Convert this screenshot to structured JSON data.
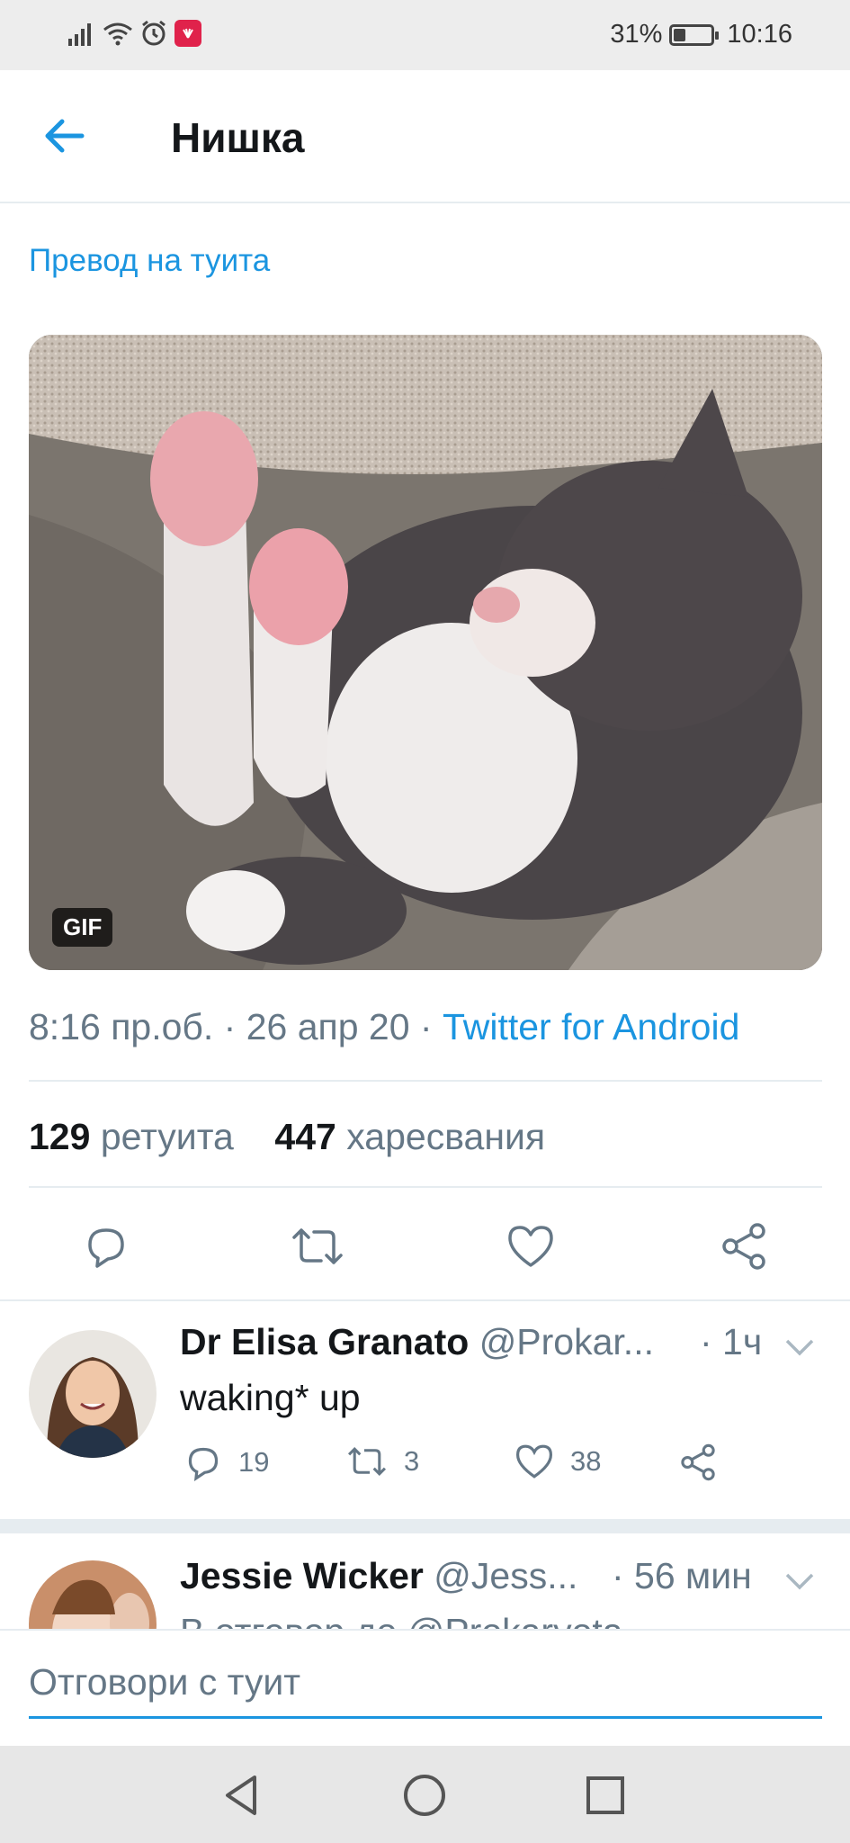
{
  "status_bar": {
    "battery": "31%",
    "battery_level": 0.31,
    "time": "10:16",
    "vendor_badge": "HUAWEI"
  },
  "header": {
    "title": "Нишка"
  },
  "tweet": {
    "translate_label": "Превод на туита",
    "media_badge": "GIF",
    "time": "8:16 пр.об.",
    "date": "26 апр 20",
    "source": "Twitter for Android",
    "retweets_count": "129",
    "retweets_label": "ретуита",
    "likes_count": "447",
    "likes_label": "харесвания"
  },
  "replies": [
    {
      "name": "Dr Elisa Granato",
      "handle": "@Prokar...",
      "time": "· 1ч",
      "text": "waking* up",
      "replies": "19",
      "retweets": "3",
      "likes": "38"
    },
    {
      "name": "Jessie Wicker",
      "handle": "@Jess...",
      "time": "· 56 мин",
      "text": "В отговор до @Prokaryota"
    }
  ],
  "reply_bar": {
    "placeholder": "Отговори с туит"
  },
  "colors": {
    "accent": "#1b95e0",
    "secondary_text": "#657786",
    "divider": "#e6ecf0"
  }
}
